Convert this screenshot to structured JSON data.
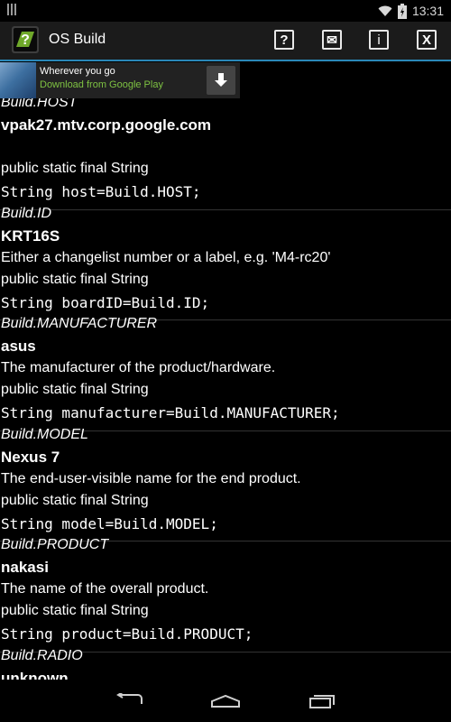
{
  "status_bar": {
    "time": "13:31",
    "battery_icon": "battery-icon",
    "wifi_icon": "wifi-icon"
  },
  "action_bar": {
    "title": "OS Build",
    "buttons": [
      {
        "name": "help",
        "label": "?"
      },
      {
        "name": "email",
        "label": "✉"
      },
      {
        "name": "info",
        "label": "i"
      },
      {
        "name": "exit",
        "label": "X"
      }
    ]
  },
  "ad": {
    "title": "Wherever you go",
    "subtitle": "Download from Google Play"
  },
  "entries": [
    {
      "name": "Build.HOST",
      "value": "vpak27.mtv.corp.google.com",
      "description": "",
      "declaration": "public static final String",
      "code": "String host=Build.HOST;"
    },
    {
      "name": "Build.ID",
      "value": "KRT16S",
      "description": "Either a changelist number or a label, e.g. 'M4-rc20'",
      "declaration": "public static final String",
      "code": "String boardID=Build.ID;"
    },
    {
      "name": "Build.MANUFACTURER",
      "value": "asus",
      "description": "The manufacturer of the product/hardware.",
      "declaration": "public static final String",
      "code": "String manufacturer=Build.MANUFACTURER;"
    },
    {
      "name": "Build.MODEL",
      "value": "Nexus 7",
      "description": "The end-user-visible name for the end product.",
      "declaration": "public static final String",
      "code": "String model=Build.MODEL;"
    },
    {
      "name": "Build.PRODUCT",
      "value": "nakasi",
      "description": "The name of the overall product.",
      "declaration": "public static final String",
      "code": "String product=Build.PRODUCT;"
    },
    {
      "name": "Build.RADIO",
      "value": "unknown",
      "description": "",
      "declaration": "",
      "code": ""
    }
  ],
  "nav_bar": {
    "back_icon": "back-icon",
    "home_icon": "home-icon",
    "recents_icon": "recents-icon"
  }
}
